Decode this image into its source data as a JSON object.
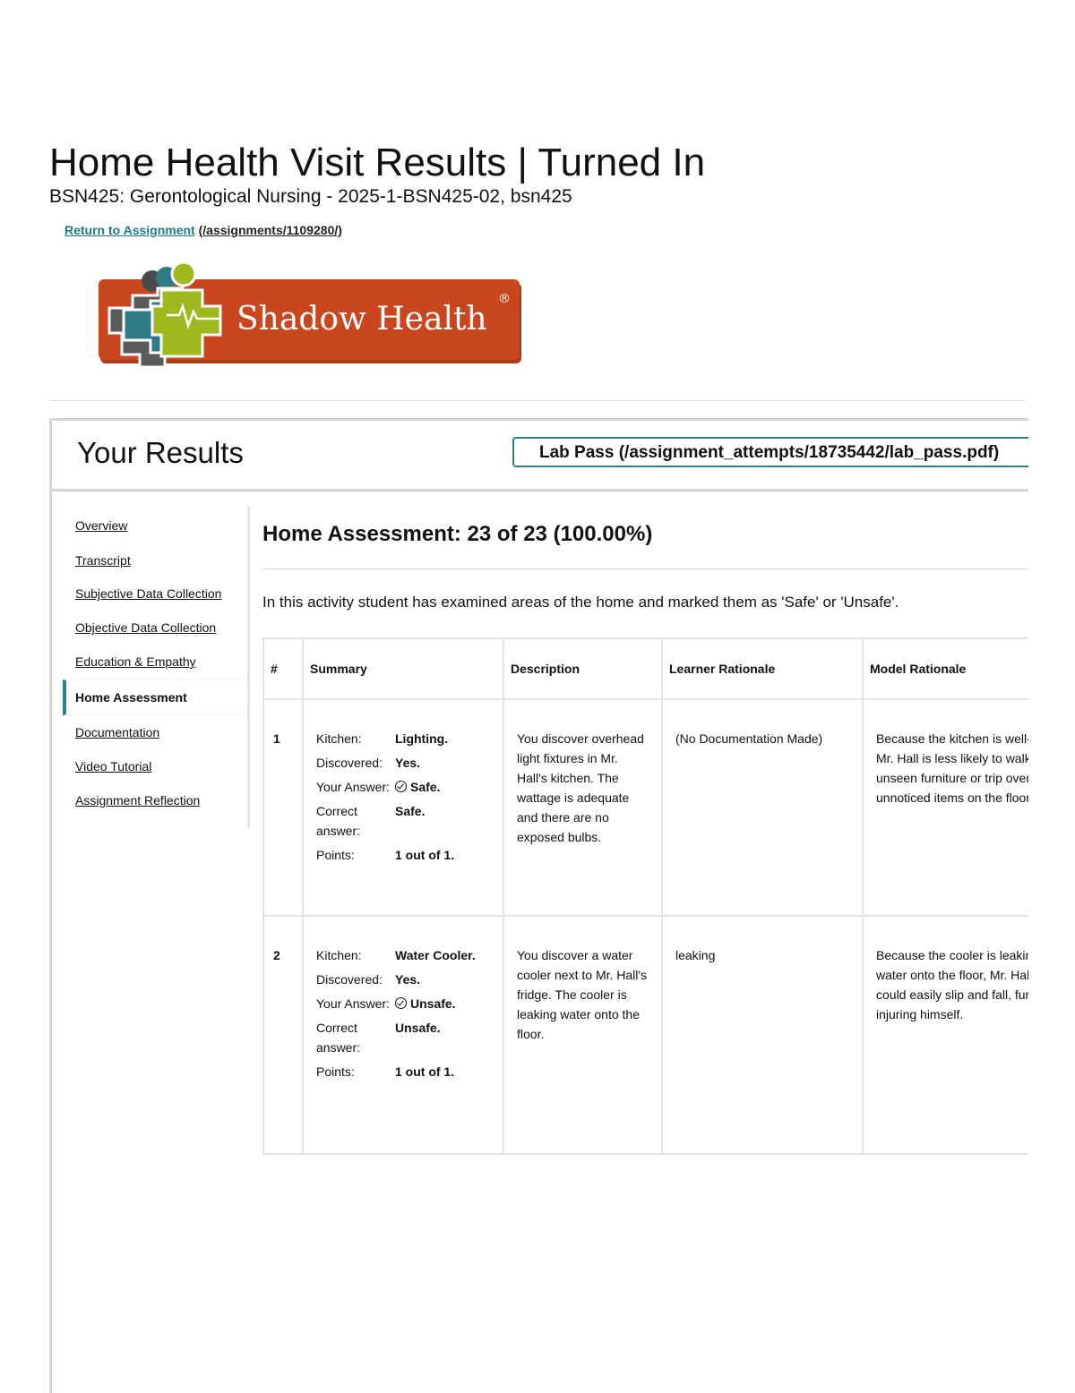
{
  "header": {
    "title": "Home Health Visit Results | Turned In",
    "course": "BSN425: Gerontological Nursing - 2025-1-BSN425-02, bsn425",
    "return_label": "Return to Assignment",
    "return_path": "(/assignments/1109280/)"
  },
  "logo": {
    "text": "Shadow Health",
    "mark": "®",
    "brand_color": "#c9461e",
    "accent_color": "#9fb81d"
  },
  "results": {
    "title": "Your Results",
    "lab_pass": "Lab Pass (/assignment_attempts/18735442/lab_pass.pdf)"
  },
  "nav": {
    "items": [
      {
        "label": "Overview"
      },
      {
        "label": "Transcript"
      },
      {
        "label": "Subjective Data Collection"
      },
      {
        "label": "Objective Data Collection"
      },
      {
        "label": "Education & Empathy"
      },
      {
        "label": "Home Assessment"
      },
      {
        "label": "Documentation"
      },
      {
        "label": "Video Tutorial"
      },
      {
        "label": "Assignment Reflection"
      }
    ],
    "active": "Home Assessment"
  },
  "section": {
    "heading": "Home Assessment: 23 of 23 (100.00%)",
    "intro": "In this activity student has examined areas of the home and marked them as 'Safe' or 'Unsafe'."
  },
  "table": {
    "columns": [
      "#",
      "Summary",
      "Description",
      "Learner Rationale",
      "Model Rationale"
    ],
    "rows": [
      {
        "num": "1",
        "area_label": "Kitchen:",
        "area_value": "Lighting.",
        "discovered_label": "Discovered:",
        "discovered_value": "Yes.",
        "answer_label": "Your Answer:",
        "answer_value": "Safe.",
        "correct_label": "Correct answer:",
        "correct_value": "Safe.",
        "points_label": "Points:",
        "points_value": "1 out of 1.",
        "description": "You discover overhead light fixtures in Mr. Hall's kitchen. The wattage is adequate and there are no exposed bulbs.",
        "learner_rationale": "(No Documentation Made)",
        "model_rationale": "Because the kitchen is well-lit, Mr. Hall is less likely to walk into unseen furniture or trip over unnoticed items on the floor."
      },
      {
        "num": "2",
        "area_label": "Kitchen:",
        "area_value": "Water Cooler.",
        "discovered_label": "Discovered:",
        "discovered_value": "Yes.",
        "answer_label": "Your Answer:",
        "answer_value": "Unsafe.",
        "correct_label": "Correct answer:",
        "correct_value": "Unsafe.",
        "points_label": "Points:",
        "points_value": "1 out of 1.",
        "description": "You discover a water cooler next to Mr. Hall's fridge. The cooler is leaking water onto the floor.",
        "learner_rationale": "leaking",
        "model_rationale": "Because the cooler is leaking water onto the floor, Mr. Hall could easily slip and fall, further injuring himself."
      }
    ]
  }
}
